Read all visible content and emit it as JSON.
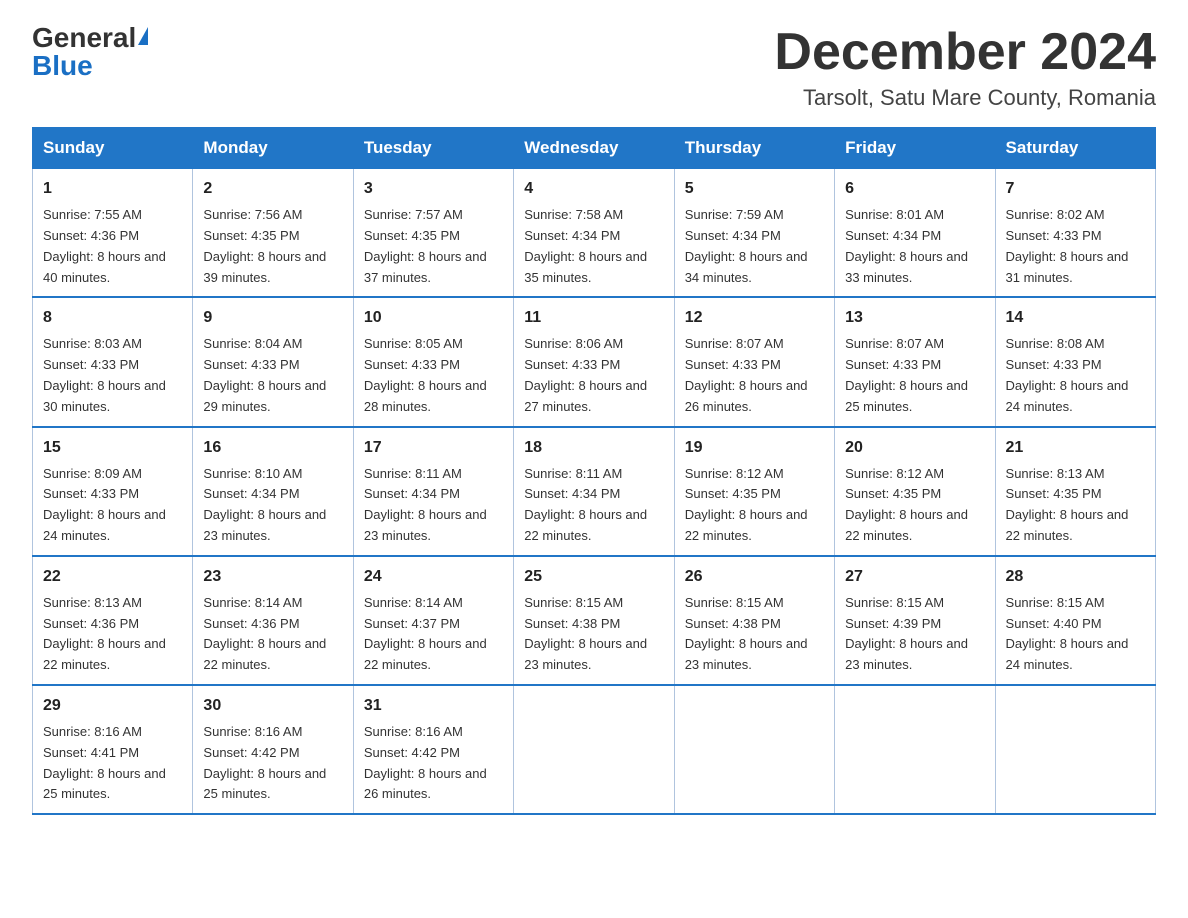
{
  "header": {
    "logo_general": "General",
    "logo_blue": "Blue",
    "month_title": "December 2024",
    "location": "Tarsolt, Satu Mare County, Romania"
  },
  "days_of_week": [
    "Sunday",
    "Monday",
    "Tuesday",
    "Wednesday",
    "Thursday",
    "Friday",
    "Saturday"
  ],
  "weeks": [
    [
      {
        "day": "1",
        "sunrise": "7:55 AM",
        "sunset": "4:36 PM",
        "daylight": "8 hours and 40 minutes."
      },
      {
        "day": "2",
        "sunrise": "7:56 AM",
        "sunset": "4:35 PM",
        "daylight": "8 hours and 39 minutes."
      },
      {
        "day": "3",
        "sunrise": "7:57 AM",
        "sunset": "4:35 PM",
        "daylight": "8 hours and 37 minutes."
      },
      {
        "day": "4",
        "sunrise": "7:58 AM",
        "sunset": "4:34 PM",
        "daylight": "8 hours and 35 minutes."
      },
      {
        "day": "5",
        "sunrise": "7:59 AM",
        "sunset": "4:34 PM",
        "daylight": "8 hours and 34 minutes."
      },
      {
        "day": "6",
        "sunrise": "8:01 AM",
        "sunset": "4:34 PM",
        "daylight": "8 hours and 33 minutes."
      },
      {
        "day": "7",
        "sunrise": "8:02 AM",
        "sunset": "4:33 PM",
        "daylight": "8 hours and 31 minutes."
      }
    ],
    [
      {
        "day": "8",
        "sunrise": "8:03 AM",
        "sunset": "4:33 PM",
        "daylight": "8 hours and 30 minutes."
      },
      {
        "day": "9",
        "sunrise": "8:04 AM",
        "sunset": "4:33 PM",
        "daylight": "8 hours and 29 minutes."
      },
      {
        "day": "10",
        "sunrise": "8:05 AM",
        "sunset": "4:33 PM",
        "daylight": "8 hours and 28 minutes."
      },
      {
        "day": "11",
        "sunrise": "8:06 AM",
        "sunset": "4:33 PM",
        "daylight": "8 hours and 27 minutes."
      },
      {
        "day": "12",
        "sunrise": "8:07 AM",
        "sunset": "4:33 PM",
        "daylight": "8 hours and 26 minutes."
      },
      {
        "day": "13",
        "sunrise": "8:07 AM",
        "sunset": "4:33 PM",
        "daylight": "8 hours and 25 minutes."
      },
      {
        "day": "14",
        "sunrise": "8:08 AM",
        "sunset": "4:33 PM",
        "daylight": "8 hours and 24 minutes."
      }
    ],
    [
      {
        "day": "15",
        "sunrise": "8:09 AM",
        "sunset": "4:33 PM",
        "daylight": "8 hours and 24 minutes."
      },
      {
        "day": "16",
        "sunrise": "8:10 AM",
        "sunset": "4:34 PM",
        "daylight": "8 hours and 23 minutes."
      },
      {
        "day": "17",
        "sunrise": "8:11 AM",
        "sunset": "4:34 PM",
        "daylight": "8 hours and 23 minutes."
      },
      {
        "day": "18",
        "sunrise": "8:11 AM",
        "sunset": "4:34 PM",
        "daylight": "8 hours and 22 minutes."
      },
      {
        "day": "19",
        "sunrise": "8:12 AM",
        "sunset": "4:35 PM",
        "daylight": "8 hours and 22 minutes."
      },
      {
        "day": "20",
        "sunrise": "8:12 AM",
        "sunset": "4:35 PM",
        "daylight": "8 hours and 22 minutes."
      },
      {
        "day": "21",
        "sunrise": "8:13 AM",
        "sunset": "4:35 PM",
        "daylight": "8 hours and 22 minutes."
      }
    ],
    [
      {
        "day": "22",
        "sunrise": "8:13 AM",
        "sunset": "4:36 PM",
        "daylight": "8 hours and 22 minutes."
      },
      {
        "day": "23",
        "sunrise": "8:14 AM",
        "sunset": "4:36 PM",
        "daylight": "8 hours and 22 minutes."
      },
      {
        "day": "24",
        "sunrise": "8:14 AM",
        "sunset": "4:37 PM",
        "daylight": "8 hours and 22 minutes."
      },
      {
        "day": "25",
        "sunrise": "8:15 AM",
        "sunset": "4:38 PM",
        "daylight": "8 hours and 23 minutes."
      },
      {
        "day": "26",
        "sunrise": "8:15 AM",
        "sunset": "4:38 PM",
        "daylight": "8 hours and 23 minutes."
      },
      {
        "day": "27",
        "sunrise": "8:15 AM",
        "sunset": "4:39 PM",
        "daylight": "8 hours and 23 minutes."
      },
      {
        "day": "28",
        "sunrise": "8:15 AM",
        "sunset": "4:40 PM",
        "daylight": "8 hours and 24 minutes."
      }
    ],
    [
      {
        "day": "29",
        "sunrise": "8:16 AM",
        "sunset": "4:41 PM",
        "daylight": "8 hours and 25 minutes."
      },
      {
        "day": "30",
        "sunrise": "8:16 AM",
        "sunset": "4:42 PM",
        "daylight": "8 hours and 25 minutes."
      },
      {
        "day": "31",
        "sunrise": "8:16 AM",
        "sunset": "4:42 PM",
        "daylight": "8 hours and 26 minutes."
      },
      null,
      null,
      null,
      null
    ]
  ],
  "labels": {
    "sunrise": "Sunrise:",
    "sunset": "Sunset:",
    "daylight": "Daylight:"
  }
}
